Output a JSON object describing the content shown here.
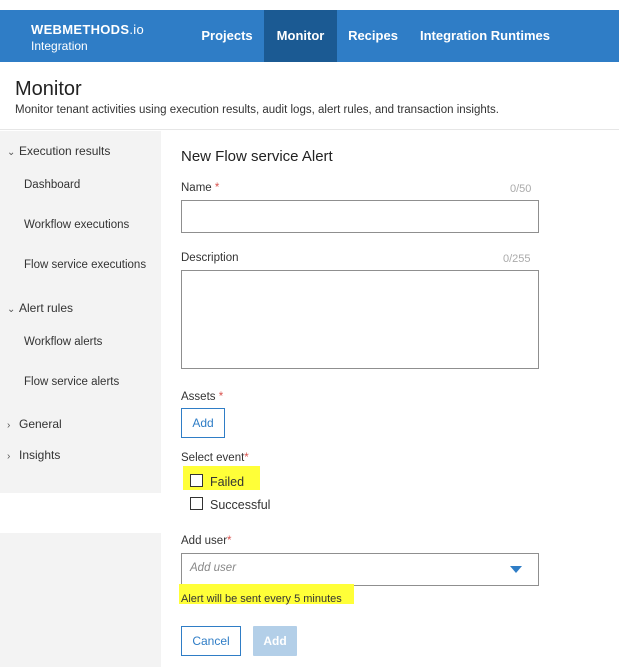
{
  "brand": {
    "name": "WEBMETHODS",
    "suffix": ".io",
    "subtitle": "Integration"
  },
  "nav": {
    "tabs": [
      "Projects",
      "Monitor",
      "Recipes",
      "Integration Runtimes"
    ],
    "active": "Monitor"
  },
  "header": {
    "title": "Monitor",
    "description": "Monitor tenant activities using execution results, audit logs, alert rules, and transaction insights."
  },
  "sidebar": {
    "groups": [
      {
        "label": "Execution results",
        "expanded": true,
        "items": [
          "Dashboard",
          "Workflow executions",
          "Flow service executions"
        ]
      },
      {
        "label": "Alert rules",
        "expanded": true,
        "items": [
          "Workflow alerts",
          "Flow service alerts"
        ]
      },
      {
        "label": "General",
        "expanded": false,
        "items": []
      },
      {
        "label": "Insights",
        "expanded": false,
        "items": []
      }
    ],
    "active_item": "Flow service alerts"
  },
  "form": {
    "title": "New Flow service Alert",
    "name": {
      "label": "Name",
      "required_mark": "*",
      "counter": "0/50",
      "value": ""
    },
    "description": {
      "label": "Description",
      "counter": "0/255",
      "value": ""
    },
    "assets": {
      "label": "Assets",
      "required_mark": "*",
      "add_label": "Add"
    },
    "event": {
      "label": "Select event",
      "required_mark": "*",
      "options": [
        {
          "label": "Failed",
          "checked": false
        },
        {
          "label": "Successful",
          "checked": false
        }
      ]
    },
    "user": {
      "label": "Add user",
      "required_mark": "*",
      "placeholder": "Add user",
      "hint": "Alert will be sent every 5 minutes"
    },
    "actions": {
      "cancel_label": "Cancel",
      "add_label": "Add"
    }
  },
  "colors": {
    "brand_blue": "#2f7dc6",
    "active_tab": "#1b5a93",
    "highlight": "#ffff38",
    "required": "#d9534f"
  }
}
